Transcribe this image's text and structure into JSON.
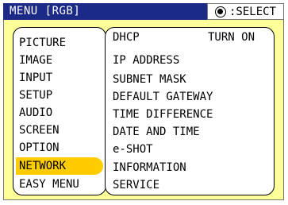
{
  "title": {
    "menu": "MENU [RGB]",
    "select_icon": "select-button-icon",
    "select_label": ":SELECT"
  },
  "left_menu": {
    "items": [
      "PICTURE",
      "IMAGE",
      "INPUT",
      "SETUP",
      "AUDIO",
      "SCREEN",
      "OPTION",
      "NETWORK",
      "EASY MENU"
    ],
    "selected": "NETWORK"
  },
  "network_menu": {
    "items": [
      "DHCP",
      "IP ADDRESS",
      "SUBNET MASK",
      "DEFAULT GATEWAY",
      "TIME DIFFERENCE",
      "DATE AND TIME",
      "e-SHOT",
      "INFORMATION",
      "SERVICE"
    ],
    "dhcp_value": "TURN ON"
  },
  "colors": {
    "title_bg": "#1a2a86",
    "panel_bg": "#ffff9a",
    "highlight": "#ffcc00"
  }
}
